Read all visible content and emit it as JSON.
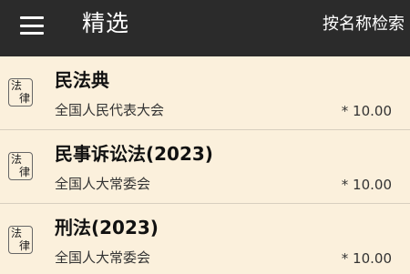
{
  "header": {
    "title": "精选",
    "search_label": "按名称检索"
  },
  "items": [
    {
      "badge_top": "法",
      "badge_bottom": "律",
      "title": "民法典",
      "publisher": "全国人民代表大会",
      "price": "* 10.00"
    },
    {
      "badge_top": "法",
      "badge_bottom": "律",
      "title": "民事诉讼法(2023)",
      "publisher": "全国人大常委会",
      "price": "* 10.00"
    },
    {
      "badge_top": "法",
      "badge_bottom": "律",
      "title": "刑法(2023)",
      "publisher": "全国人大常委会",
      "price": "* 10.00"
    }
  ]
}
